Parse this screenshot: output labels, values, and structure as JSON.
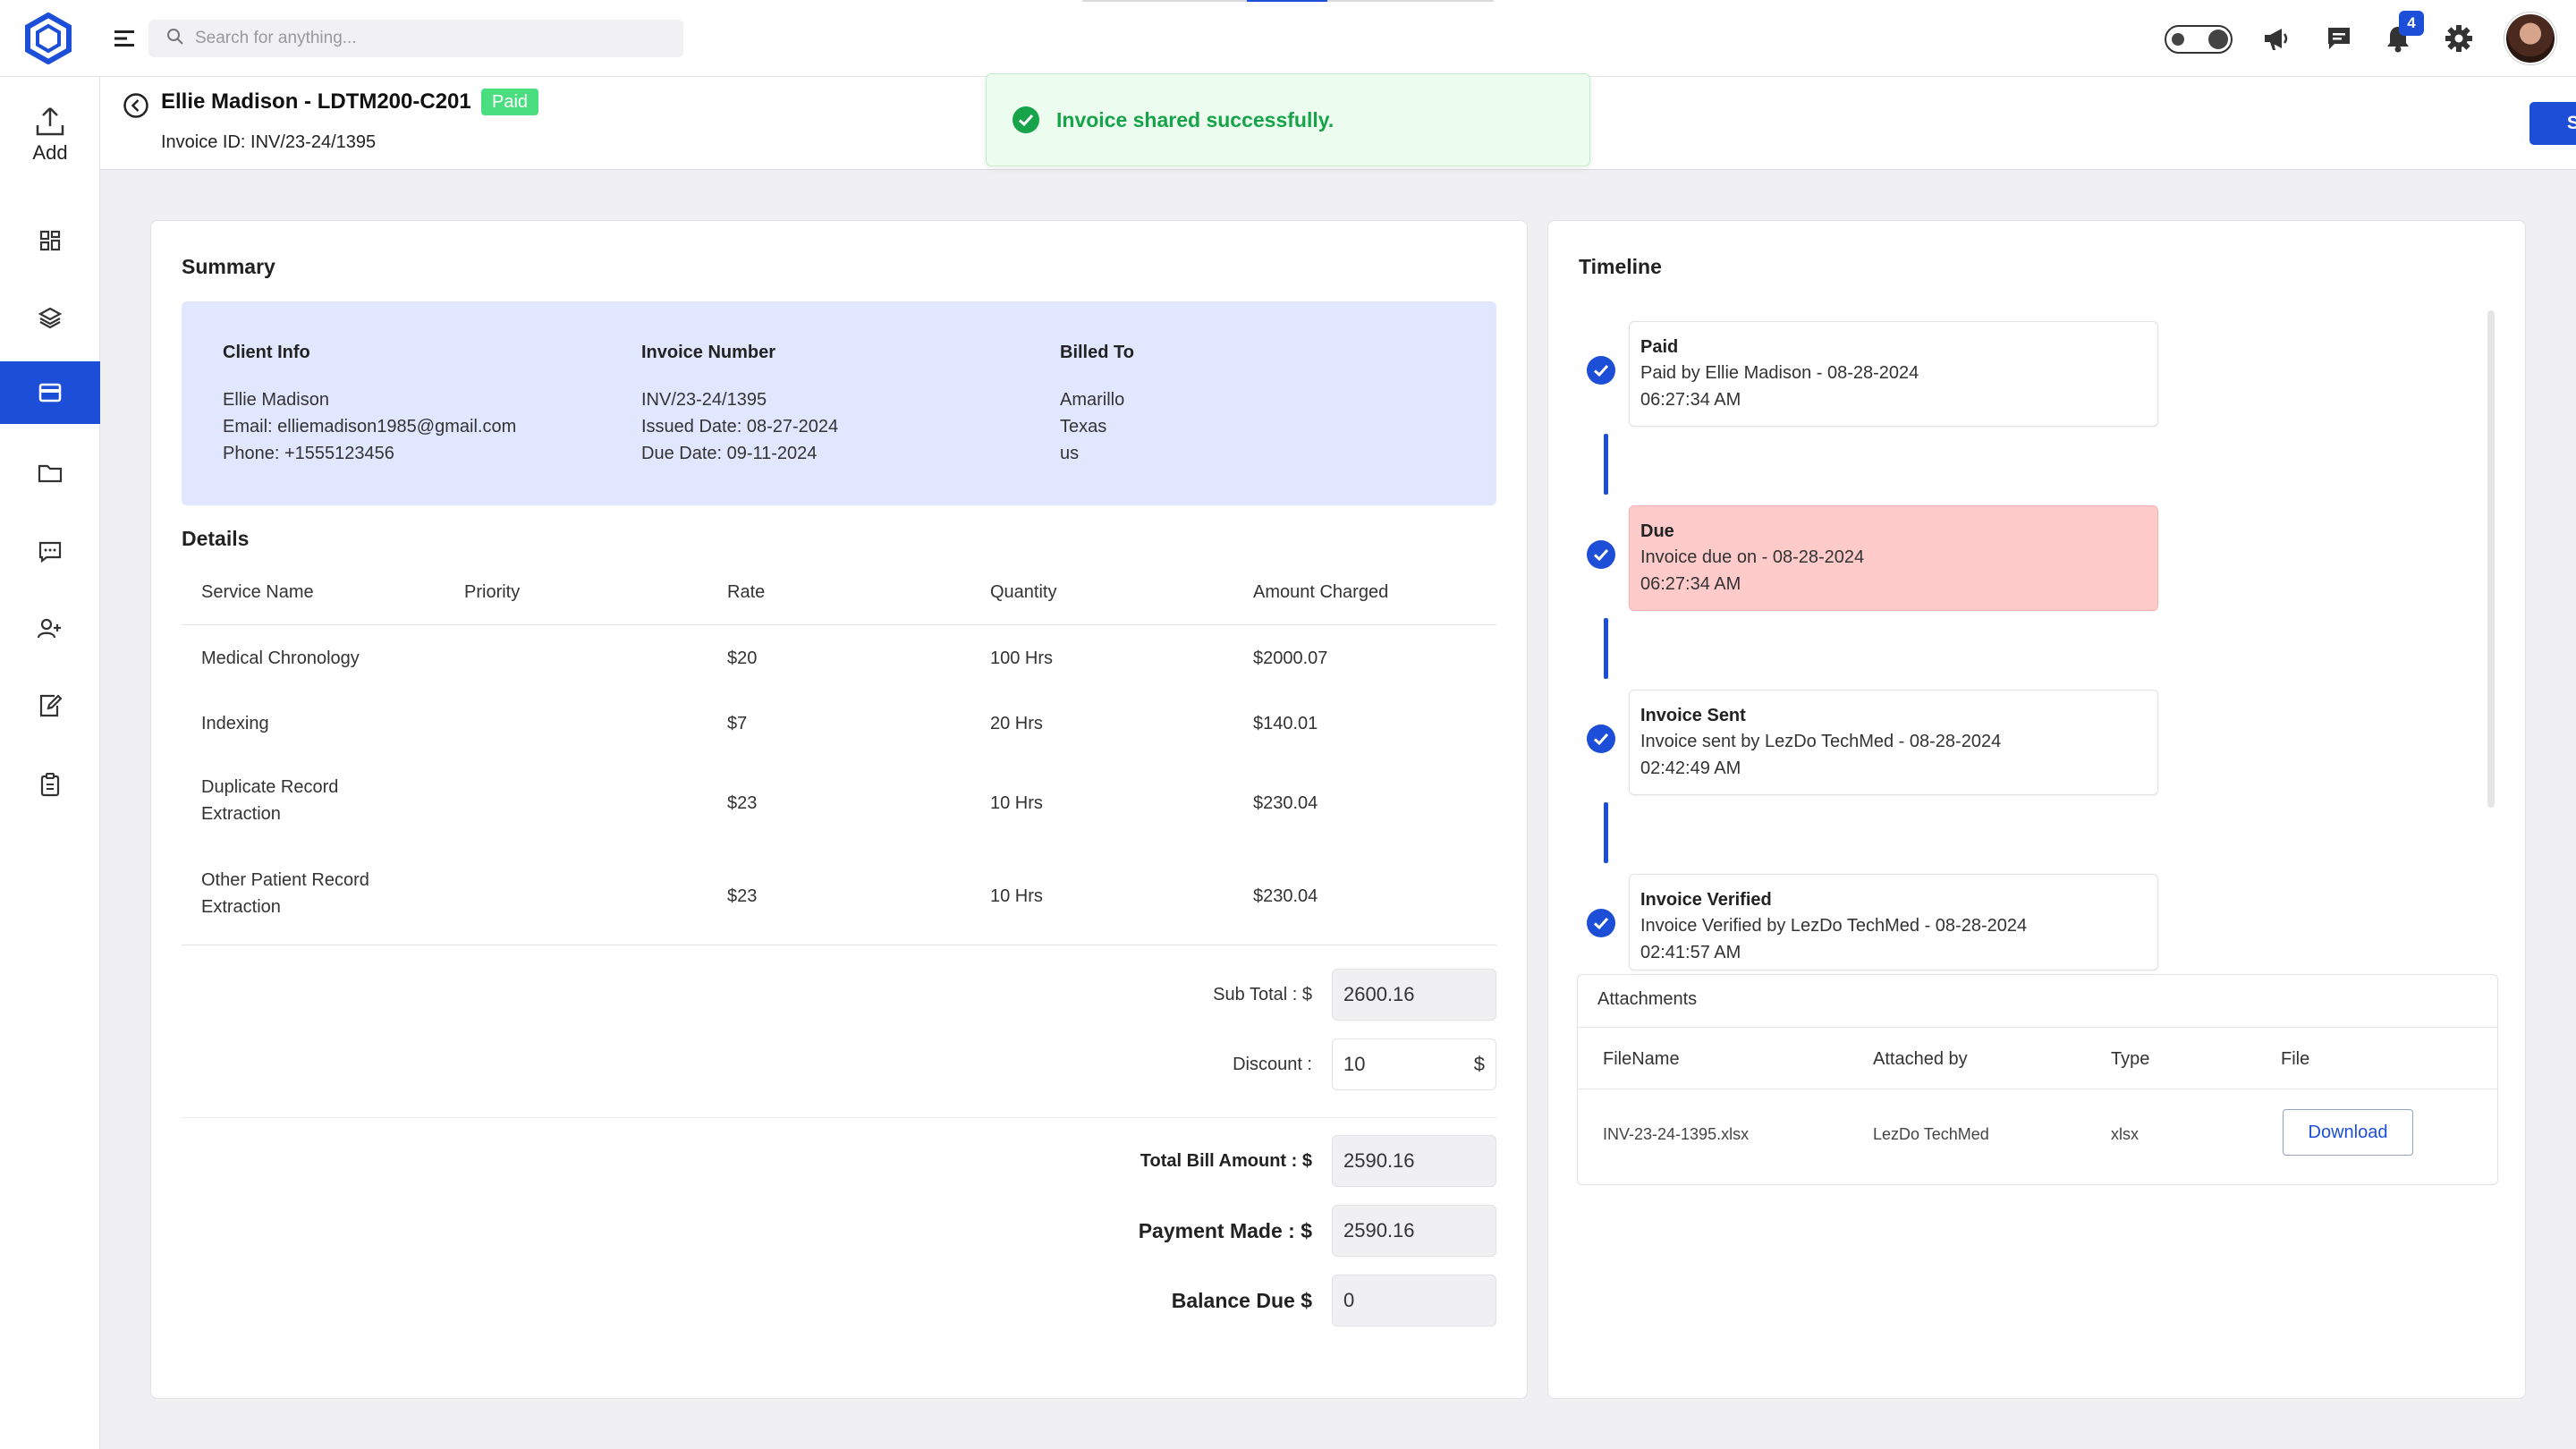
{
  "app": {
    "search_placeholder": "Search for anything...",
    "notification_count": "4",
    "accent_color": "#1d4ed8",
    "icons": [
      "logo-icon",
      "hamburger-icon",
      "search-icon",
      "theme-toggle-icon",
      "announcement-icon",
      "chat-icon",
      "bell-icon",
      "gear-icon"
    ]
  },
  "sidebar": {
    "add_label": "Add",
    "items": [
      {
        "icon": "dashboard-icon"
      },
      {
        "icon": "layers-icon"
      },
      {
        "icon": "billing-card-icon",
        "active": true
      },
      {
        "icon": "folder-icon"
      },
      {
        "icon": "message-icon"
      },
      {
        "icon": "users-icon"
      },
      {
        "icon": "edit-note-icon"
      },
      {
        "icon": "clipboard-icon"
      }
    ]
  },
  "header": {
    "title": "Ellie Madison - LDTM200-C201",
    "status": "Paid",
    "invoice_id": "Invoice ID: INV/23-24/1395",
    "share_label": "Share"
  },
  "toast": {
    "message": "Invoice shared successfully."
  },
  "summary": {
    "title": "Summary",
    "client": {
      "heading": "Client Info",
      "lines": [
        "Ellie Madison",
        "Email: elliemadison1985@gmail.com",
        "Phone: +1555123456"
      ]
    },
    "invoice": {
      "heading": "Invoice Number",
      "lines": [
        "INV/23-24/1395",
        "Issued Date: 08-27-2024",
        "Due Date: 09-11-2024"
      ]
    },
    "billed": {
      "heading": "Billed To",
      "lines": [
        "Amarillo",
        "Texas",
        "us"
      ]
    }
  },
  "details": {
    "title": "Details",
    "headers": [
      "Service Name",
      "Priority",
      "Rate",
      "Quantity",
      "Amount Charged"
    ],
    "rows": [
      {
        "name": [
          "Medical Chronology"
        ],
        "priority": "",
        "rate": "$20",
        "qty": "100 Hrs",
        "amount": "$2000.07"
      },
      {
        "name": [
          "Indexing"
        ],
        "priority": "",
        "rate": "$7",
        "qty": "20 Hrs",
        "amount": "$140.01"
      },
      {
        "name": [
          "Duplicate Record",
          "Extraction"
        ],
        "priority": "",
        "rate": "$23",
        "qty": "10 Hrs",
        "amount": "$230.04"
      },
      {
        "name": [
          "Other Patient Record",
          "Extraction"
        ],
        "priority": "",
        "rate": "$23",
        "qty": "10 Hrs",
        "amount": "$230.04"
      }
    ]
  },
  "totals": {
    "subtotal_label": "Sub Total : $",
    "subtotal_value": "2600.16",
    "discount_label": "Discount :",
    "discount_value": "10",
    "discount_suffix": "$",
    "total_label": "Total Bill Amount : $",
    "total_value": "2590.16",
    "payment_label": "Payment Made : $",
    "payment_value": "2590.16",
    "balance_label": "Balance Due $",
    "balance_value": "0"
  },
  "timeline": {
    "title": "Timeline",
    "events": [
      {
        "title": "Paid",
        "desc": "Paid by Ellie Madison - 08-28-2024",
        "time": "06:27:34 AM",
        "type": "normal"
      },
      {
        "title": "Due",
        "desc": "Invoice due on - 08-28-2024",
        "time": "06:27:34 AM",
        "type": "due"
      },
      {
        "title": "Invoice Sent",
        "desc": "Invoice sent by LezDo TechMed - 08-28-2024",
        "time": "02:42:49 AM",
        "type": "normal"
      },
      {
        "title": "Invoice Verified",
        "desc": "Invoice Verified by LezDo TechMed - 08-28-2024",
        "time": "02:41:57 AM",
        "type": "normal"
      }
    ],
    "due_color": "#fecaca"
  },
  "attachments": {
    "title": "Attachments",
    "headers": [
      "FileName",
      "Attached by",
      "Type",
      "File"
    ],
    "rows": [
      {
        "filename": "INV-23-24-1395.xlsx",
        "attached_by": "LezDo TechMed",
        "type": "xlsx",
        "action": "Download"
      }
    ]
  }
}
